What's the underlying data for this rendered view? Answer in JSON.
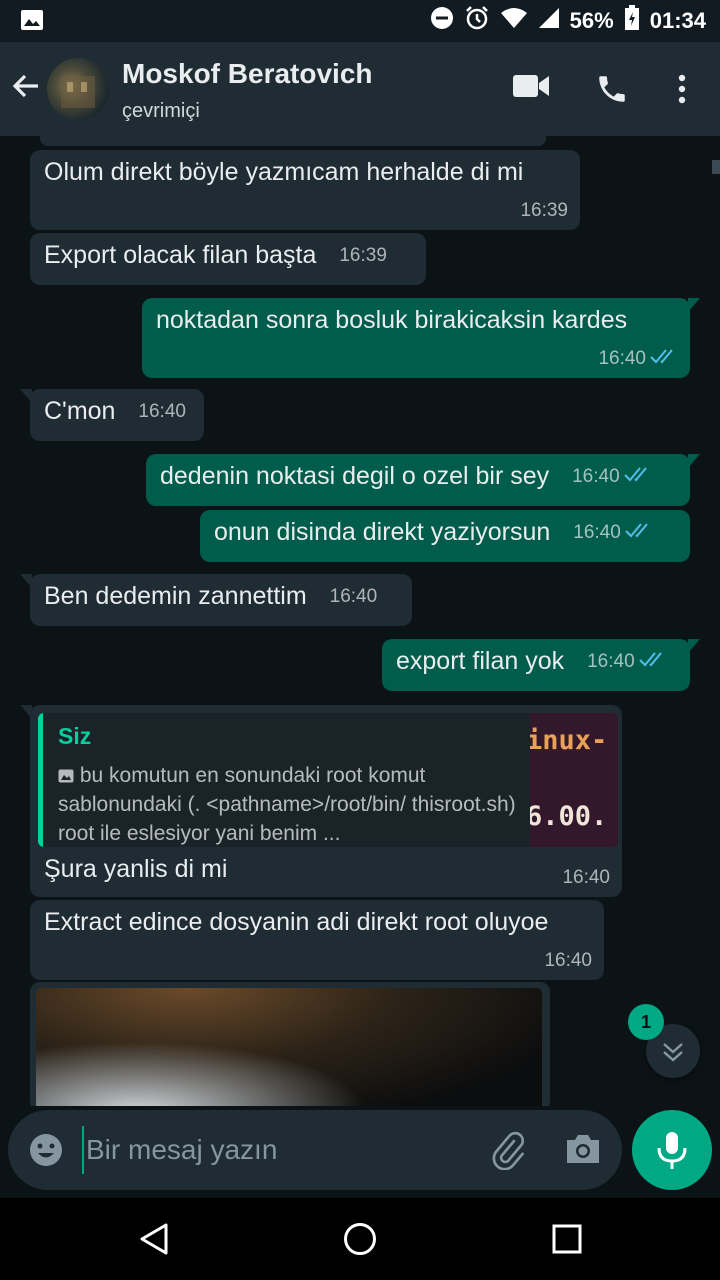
{
  "status_bar": {
    "battery": "56%",
    "time": "01:34"
  },
  "header": {
    "name": "Moskof Beratovich",
    "status": "çevrimiçi"
  },
  "messages": [
    {
      "dir": "in",
      "text": "Olum direkt böyle yazmıcam herhalde di mi",
      "time": "16:39"
    },
    {
      "dir": "in",
      "text": "Export olacak filan başta",
      "time": "16:39"
    },
    {
      "dir": "out",
      "text": "noktadan sonra bosluk birakicaksin kardes",
      "time": "16:40"
    },
    {
      "dir": "in",
      "text": "C'mon",
      "time": "16:40"
    },
    {
      "dir": "out",
      "text": "dedenin noktasi degil o ozel bir sey",
      "time": "16:40"
    },
    {
      "dir": "out",
      "text": "onun disinda direkt yaziyorsun",
      "time": "16:40"
    },
    {
      "dir": "in",
      "text": "Ben dedemin zannettim",
      "time": "16:40"
    },
    {
      "dir": "out",
      "text": "export filan yok",
      "time": "16:40"
    },
    {
      "dir": "in",
      "text": "Şura yanlis di mi",
      "time": "16:40",
      "quote": {
        "author": "Siz",
        "text": "bu komutun en sonundaki root komut sablonundaki (. <pathname>/root/bin/ thisroot.sh) root ile eslesiyor yani benim ...",
        "thumb_line1": "inux-",
        "thumb_line2": "6.00."
      }
    },
    {
      "dir": "in",
      "text": "Extract edince dosyanin adi direkt root oluyoe",
      "time": "16:40"
    }
  ],
  "unread_count": "1",
  "composer": {
    "placeholder": "Bir mesaj yazın"
  },
  "colors": {
    "accent": "#00a884",
    "outgoing": "#005c4b",
    "incoming": "#1f2c33",
    "read_ticks": "#53bdeb"
  }
}
